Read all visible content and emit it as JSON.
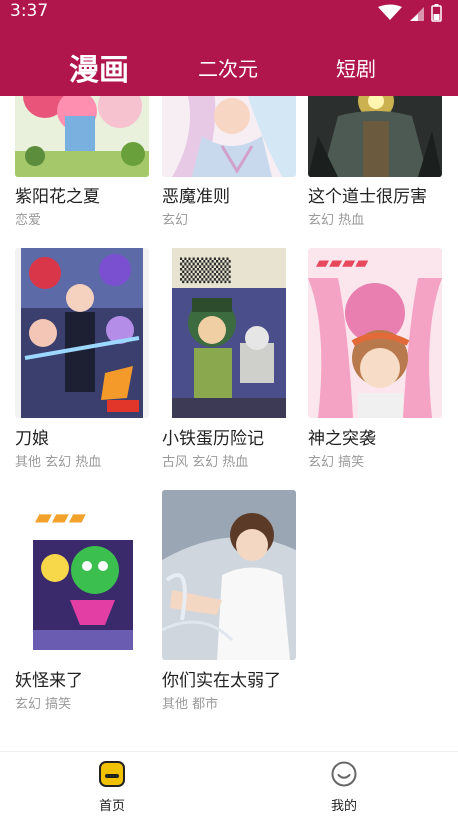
{
  "status_bar": {
    "time": "3:37"
  },
  "tabs": [
    {
      "label": "漫画",
      "active": true
    },
    {
      "label": "二次元",
      "active": false
    },
    {
      "label": "短剧",
      "active": false
    }
  ],
  "comics": [
    {
      "title": "紫阳花之夏",
      "tags": "恋爱"
    },
    {
      "title": "恶魔准则",
      "tags": "玄幻"
    },
    {
      "title": "这个道士很厉害",
      "tags": "玄幻 热血"
    },
    {
      "title": "刀娘",
      "tags": "其他 玄幻 热血"
    },
    {
      "title": "小铁蛋历险记",
      "tags": "古风 玄幻 热血"
    },
    {
      "title": "神之突袭",
      "tags": "玄幻 搞笑"
    },
    {
      "title": "妖怪来了",
      "tags": "玄幻 搞笑"
    },
    {
      "title": "你们实在太弱了",
      "tags": "其他 都市"
    }
  ],
  "bottom_nav": [
    {
      "label": "首页",
      "icon": "home-icon",
      "active": true
    },
    {
      "label": "我的",
      "icon": "smiley-icon",
      "active": false
    }
  ],
  "colors": {
    "brand": "#b0154c",
    "nav_icon_active": "#f2c200"
  }
}
